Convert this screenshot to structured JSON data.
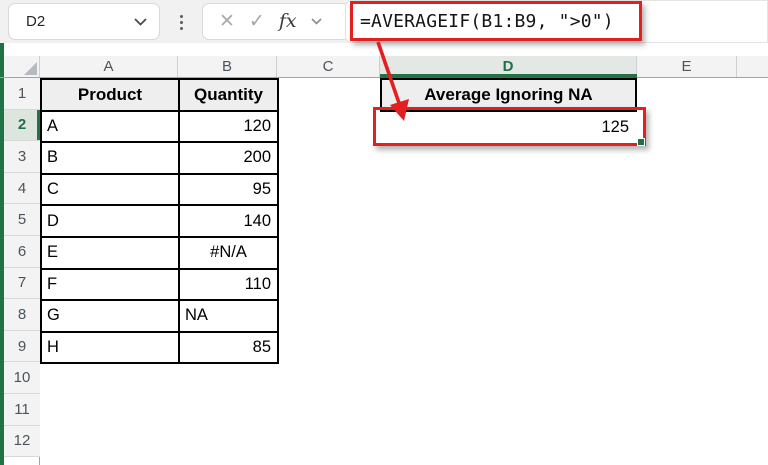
{
  "name_box": {
    "value": "D2"
  },
  "formula_bar": {
    "formula": "=AVERAGEIF(B1:B9, \">0\")",
    "cancel_icon": "✕",
    "enter_icon": "✓",
    "fx_label": "fx"
  },
  "sheet": {
    "column_headers": [
      "A",
      "B",
      "C",
      "D",
      "E",
      ""
    ],
    "row_headers": [
      "1",
      "2",
      "3",
      "4",
      "5",
      "6",
      "7",
      "8",
      "9",
      "10",
      "11",
      "12"
    ],
    "selected": {
      "cell": "D2",
      "column": "D",
      "row": "2"
    },
    "table": {
      "col_a_header": "Product",
      "col_b_header": "Quantity",
      "rows": [
        {
          "product": "A",
          "quantity": "120"
        },
        {
          "product": "B",
          "quantity": "200"
        },
        {
          "product": "C",
          "quantity": "95"
        },
        {
          "product": "D",
          "quantity": "140"
        },
        {
          "product": "E",
          "quantity": "#N/A"
        },
        {
          "product": "F",
          "quantity": "110"
        },
        {
          "product": "G",
          "quantity": "NA"
        },
        {
          "product": "H",
          "quantity": "85"
        }
      ]
    },
    "result": {
      "header": "Average Ignoring NA",
      "value": "125"
    }
  },
  "colors": {
    "excel_green": "#217346",
    "annotation_red": "#e1201f"
  }
}
